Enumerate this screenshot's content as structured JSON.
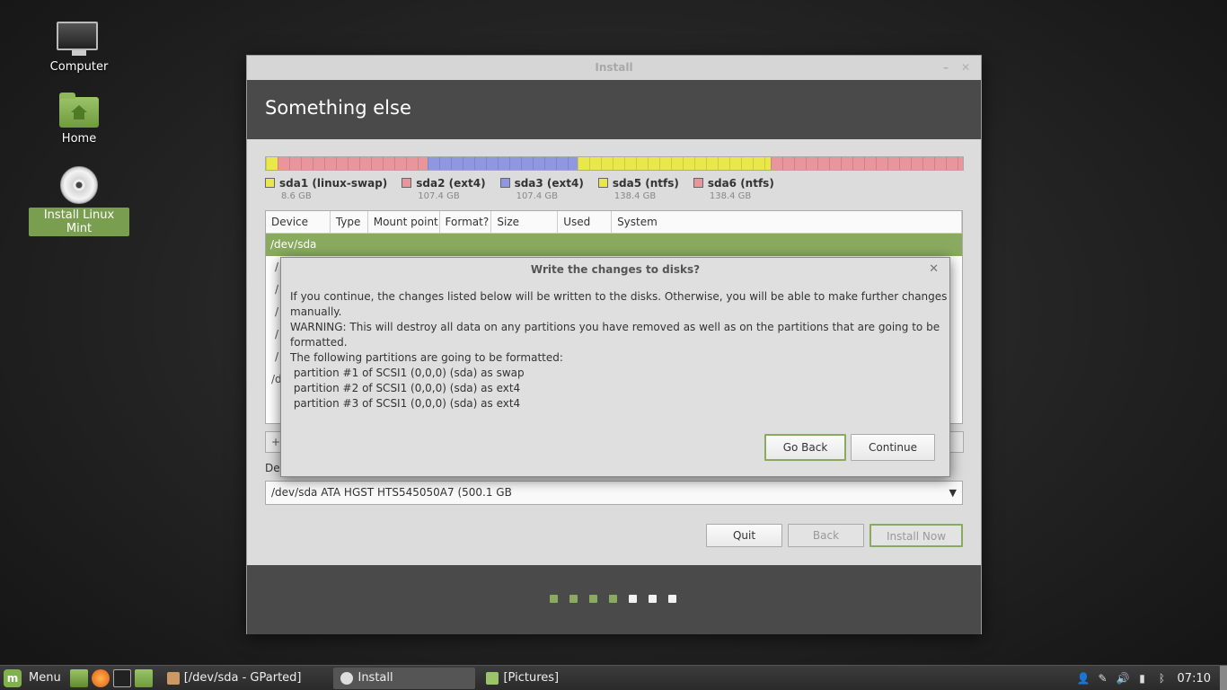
{
  "desktop": {
    "icons": [
      {
        "label": "Computer"
      },
      {
        "label": "Home"
      },
      {
        "label": "Install Linux Mint"
      }
    ]
  },
  "window": {
    "title": "Install",
    "min_glyph": "–",
    "close_glyph": "✕",
    "header": "Something else"
  },
  "partition_bar": {
    "segments": [
      {
        "color": "#e8e84a",
        "fraction": 0.017
      },
      {
        "color": "#e8959b",
        "fraction": 0.215
      },
      {
        "color": "#8f97e0",
        "fraction": 0.215
      },
      {
        "color": "#e8e84a",
        "fraction": 0.277
      },
      {
        "color": "#e8959b",
        "fraction": 0.276
      }
    ]
  },
  "legend": [
    {
      "name": "sda1 (linux-swap)",
      "size": "8.6 GB",
      "color": "#e8e84a"
    },
    {
      "name": "sda2 (ext4)",
      "size": "107.4 GB",
      "color": "#e8959b"
    },
    {
      "name": "sda3 (ext4)",
      "size": "107.4 GB",
      "color": "#8f97e0"
    },
    {
      "name": "sda5 (ntfs)",
      "size": "138.4 GB",
      "color": "#e8e84a"
    },
    {
      "name": "sda6 (ntfs)",
      "size": "138.4 GB",
      "color": "#e8959b"
    }
  ],
  "table": {
    "columns": [
      "Device",
      "Type",
      "Mount point",
      "Format?",
      "Size",
      "Used",
      "System"
    ],
    "selected_row": "/dev/sda",
    "ghost_rows": [
      "/",
      "/",
      "/",
      "/",
      "/",
      "/d"
    ]
  },
  "partition_controls": {
    "add": "+"
  },
  "boot_label": "De",
  "device_select": {
    "value": "/dev/sda   ATA HGST HTS545050A7 (500.1 GB",
    "arrow": "▼"
  },
  "buttons": {
    "quit": "Quit",
    "back": "Back",
    "install_now": "Install Now"
  },
  "progress": {
    "steps_total": 7,
    "steps_done": 4,
    "done_color": "#8aab5f",
    "todo_color": "#f2f2f2"
  },
  "dialog": {
    "title": "Write the changes to disks?",
    "close_glyph": "✕",
    "line1": "If you continue, the changes listed below will be written to the disks. Otherwise, you will be able to make further changes manually.",
    "warning": "WARNING: This will destroy all data on any partitions you have removed as well as on the partitions that are going to be formatted.",
    "list_heading": "The following partitions are going to be formatted:",
    "partitions": [
      " partition #1 of SCSI1 (0,0,0) (sda) as swap",
      " partition #2 of SCSI1 (0,0,0) (sda) as ext4",
      " partition #3 of SCSI1 (0,0,0) (sda) as ext4"
    ],
    "go_back": "Go Back",
    "continue": "Continue"
  },
  "taskbar": {
    "menu_label": "Menu",
    "tasks": [
      {
        "label": "[/dev/sda - GParted]"
      },
      {
        "label": "Install"
      },
      {
        "label": "[Pictures]"
      }
    ],
    "tray_icons": [
      "user-icon",
      "pen-icon",
      "volume-icon",
      "battery-icon",
      "bluetooth-icon"
    ],
    "clock": "07:10"
  }
}
